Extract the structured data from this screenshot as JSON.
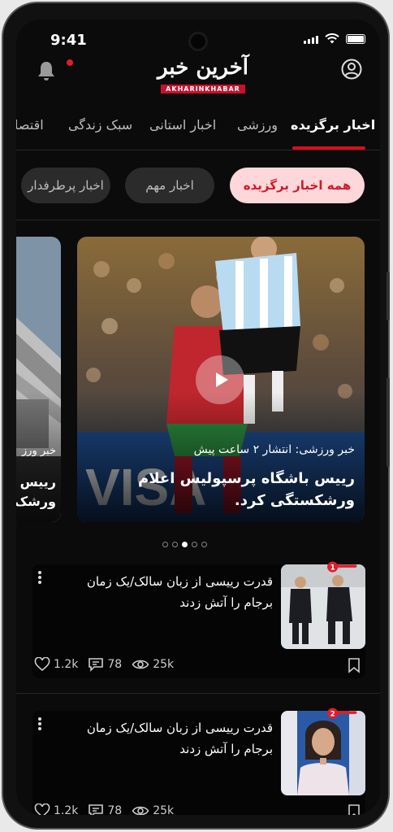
{
  "status": {
    "time": "9:41"
  },
  "logo": {
    "text": "آخرین خبر",
    "subtext": "AKHARINKHABAR"
  },
  "tabs": [
    {
      "label": "اخبار برگزیده"
    },
    {
      "label": "ورزشی"
    },
    {
      "label": "اخبار استانی"
    },
    {
      "label": "سبک زندگی"
    },
    {
      "label": "اقتصا"
    }
  ],
  "chips": [
    {
      "label": "همه اخبار برگزیده"
    },
    {
      "label": "اخبار مهم"
    },
    {
      "label": "اخبار پرطرفدار"
    }
  ],
  "carousel": {
    "main": {
      "meta": "خبر ورزشی: انتشار ۲ ساعت پیش",
      "title": "رییس باشگاه پرسپولیس اعلام ورشکستگی کرد."
    },
    "side": {
      "meta": "خبر ورز",
      "title_line1": "رییس",
      "title_line2": "ورشک"
    },
    "pages": 5,
    "current_page": 3
  },
  "news": [
    {
      "rank": "1",
      "title": "قدرت رییسی از زبان سالک/یک زمان برجام را آتش زدند",
      "likes": "1.2k",
      "comments": "78",
      "views": "25k"
    },
    {
      "rank": "2",
      "title": "قدرت رییسی از زبان سالک/یک زمان برجام را آتش زدند",
      "likes": "1.2k",
      "comments": "78",
      "views": "25k"
    }
  ],
  "colors": {
    "accent": "#d40f1f",
    "chip_active_bg": "#fdd7d9",
    "chip_active_text": "#d11a2a"
  }
}
